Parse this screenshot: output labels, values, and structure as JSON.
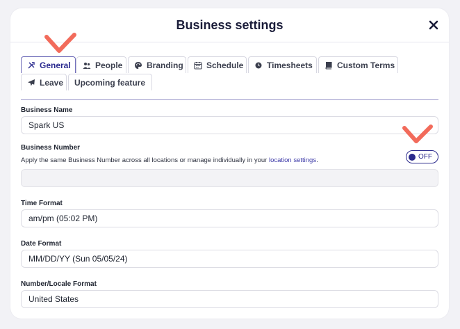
{
  "modal": {
    "title": "Business settings",
    "close_icon": "close-icon"
  },
  "tabs": [
    {
      "label": "General",
      "icon": "tools-icon",
      "active": true
    },
    {
      "label": "People",
      "icon": "people-icon",
      "active": false
    },
    {
      "label": "Branding",
      "icon": "palette-icon",
      "active": false
    },
    {
      "label": "Schedule",
      "icon": "calendar-icon",
      "active": false
    },
    {
      "label": "Timesheets",
      "icon": "clock-icon",
      "active": false
    },
    {
      "label": "Custom Terms",
      "icon": "book-icon",
      "active": false
    },
    {
      "label": "Leave",
      "icon": "plane-icon",
      "active": false
    },
    {
      "label": "Upcoming feature",
      "icon": "",
      "active": false
    }
  ],
  "fields": {
    "business_name": {
      "label": "Business Name",
      "value": "Spark US"
    },
    "business_number": {
      "label": "Business Number",
      "helper_text": "Apply the same Business Number across all locations or manage individually in your ",
      "helper_link": "location settings",
      "helper_suffix": ".",
      "value": "",
      "toggle_label": "OFF"
    },
    "time_format": {
      "label": "Time Format",
      "value": "am/pm (05:02 PM)"
    },
    "date_format": {
      "label": "Date Format",
      "value": "MM/DD/YY (Sun 05/05/24)"
    },
    "locale_format": {
      "label": "Number/Locale Format",
      "value": "United States"
    }
  },
  "colors": {
    "accent": "#2b2a8c",
    "annotation": "#f26b5b",
    "background": "#f2f2f6"
  }
}
